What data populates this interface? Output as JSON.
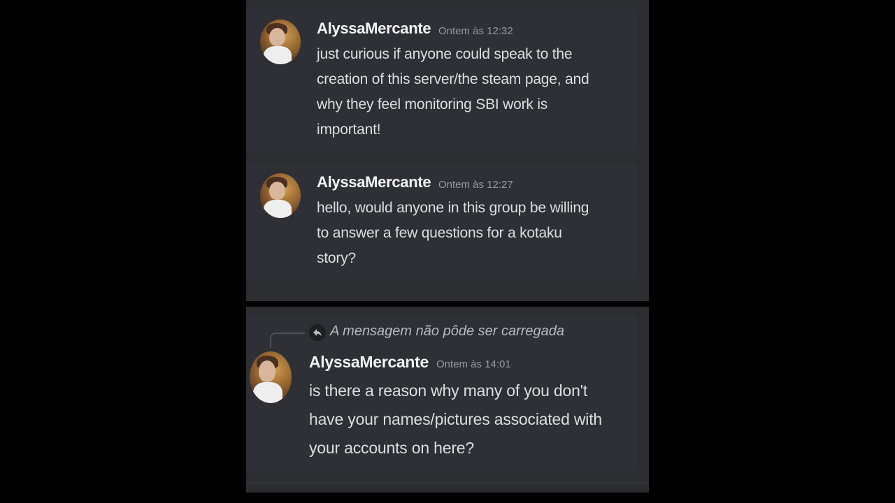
{
  "messages": [
    {
      "author": "AlyssaMercante",
      "timestamp": "Ontem às 12:32",
      "lines": [
        "just curious if anyone could speak to the",
        "creation of this server/the steam page, and",
        "why they feel monitoring SBI work is",
        "important!"
      ]
    },
    {
      "author": "AlyssaMercante",
      "timestamp": "Ontem às 12:27",
      "lines": [
        "hello, would anyone in this group be willing",
        "to answer a few questions for a kotaku",
        "story?"
      ]
    },
    {
      "reply_notice": "A mensagem não pôde ser carregada",
      "author": "AlyssaMercante",
      "timestamp": "Ontem às 14:01",
      "lines": [
        "is there a reason why many of you don't",
        "have your names/pictures associated with",
        "your accounts on here?"
      ]
    }
  ],
  "icons": {
    "reply": "reply-arrow-icon",
    "avatar": "user-avatar"
  },
  "colors": {
    "background": "#000000",
    "panel": "#2b2d31",
    "message_bg": "#2e3035",
    "author": "#f2f3f5",
    "timestamp": "#949ba4",
    "text": "#dbdee1"
  }
}
